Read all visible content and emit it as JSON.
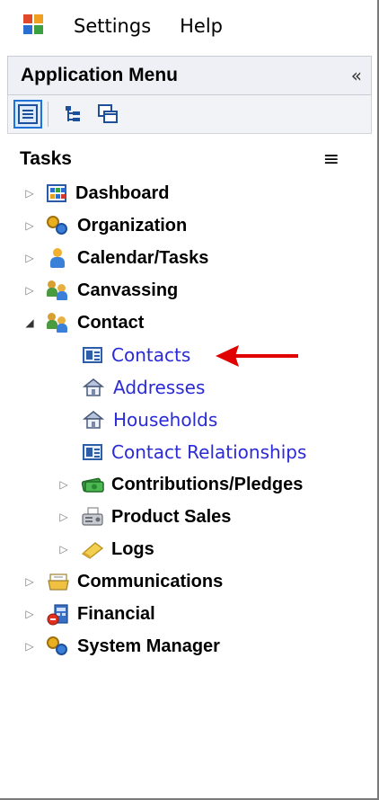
{
  "menubar": {
    "items": [
      "Settings",
      "Help"
    ]
  },
  "app_menu": {
    "title": "Application Menu",
    "collapse_glyph": "«"
  },
  "toolbar": {
    "buttons": [
      "list-view-icon",
      "tree-view-icon",
      "windows-view-icon"
    ]
  },
  "tasks": {
    "title": "Tasks",
    "menu_glyph": "≡"
  },
  "tree": {
    "expander_closed": "▷",
    "expander_open": "◢",
    "items": [
      {
        "label": "Dashboard",
        "icon": "dashboard-icon"
      },
      {
        "label": "Organization",
        "icon": "organization-icon"
      },
      {
        "label": "Calendar/Tasks",
        "icon": "person-icon"
      },
      {
        "label": "Canvassing",
        "icon": "people-icon"
      },
      {
        "label": "Contact",
        "icon": "people-icon",
        "expanded": true
      },
      {
        "label": "Contacts",
        "icon": "contact-card-icon"
      },
      {
        "label": "Addresses",
        "icon": "house-icon"
      },
      {
        "label": "Households",
        "icon": "house-icon"
      },
      {
        "label": "Contact Relationships",
        "icon": "contact-card-icon"
      },
      {
        "label": "Contributions/Pledges",
        "icon": "money-icon"
      },
      {
        "label": "Product Sales",
        "icon": "fax-icon"
      },
      {
        "label": "Logs",
        "icon": "log-icon"
      },
      {
        "label": "Communications",
        "icon": "communications-icon"
      },
      {
        "label": "Financial",
        "icon": "financial-icon"
      },
      {
        "label": "System Manager",
        "icon": "organization-icon"
      }
    ]
  },
  "colors": {
    "link": "#2a2ad6",
    "arrow": "#e00000",
    "header_bg": "#eef0f5"
  }
}
